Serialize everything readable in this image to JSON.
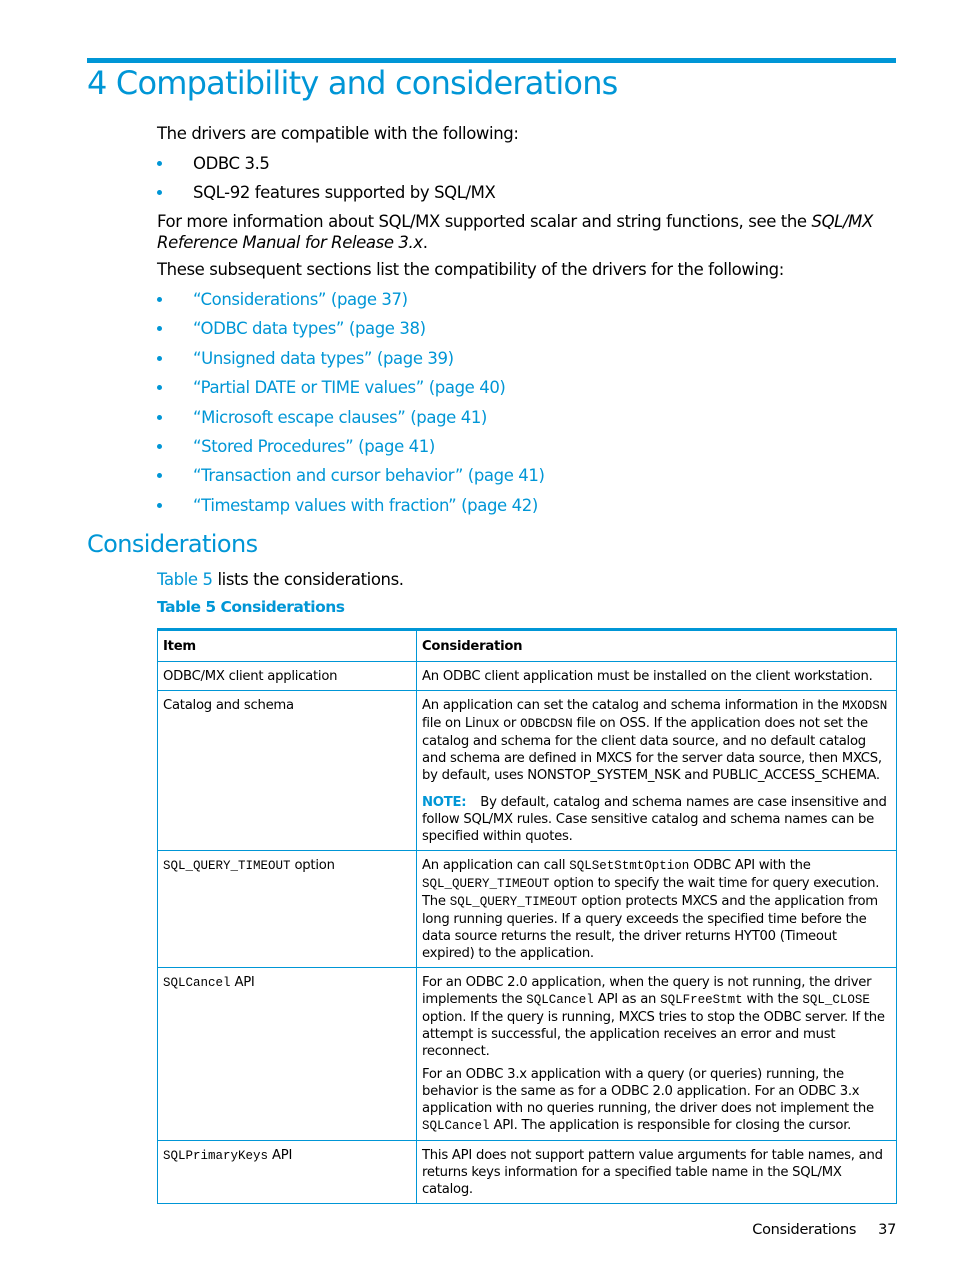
{
  "chapter": {
    "title": "4 Compatibility and considerations",
    "intro": "The drivers are compatible with the following:",
    "compat_items": [
      "ODBC 3.5",
      "SQL-92 features supported by SQL/MX"
    ],
    "more_info_text": "For more information about SQL/MX supported scalar and string functions, see the ",
    "more_info_ref": "SQL/MX Reference Manual for Release 3.x",
    "more_info_end": ".",
    "sections_intro": "These subsequent sections list the compatibility of the drivers for the following:",
    "section_links": [
      "“Considerations” (page 37)",
      "“ODBC data types” (page 38)",
      "“Unsigned data types” (page 39)",
      "“Partial DATE or TIME values” (page 40)",
      "“Microsoft escape clauses” (page 41)",
      "“Stored Procedures” (page 41)",
      "“Transaction and cursor behavior” (page 41)",
      "“Timestamp values with fraction” (page 42)"
    ]
  },
  "considerations": {
    "title": "Considerations",
    "table_ref_link": "Table 5",
    "table_ref_text": " lists the considerations.",
    "table_caption": "Table 5 Considerations",
    "table": {
      "headers": [
        "Item",
        "Consideration"
      ],
      "rows": [
        {
          "item_text": "ODBC/MX client application",
          "p1": "An ODBC client application must be installed on the client workstation."
        },
        {
          "item_text": "Catalog and schema",
          "p1_a": "An application can set the catalog and schema information in the ",
          "p1_code1": "MXODSN",
          "p1_b": " file on Linux or ",
          "p1_code2": "ODBCDSN",
          "p1_c": " file on OSS. If the application does not set the catalog and schema for the client data source, and no default catalog and schema are defined in MXCS for the server data source, then MXCS, by default, uses NONSTOP_SYSTEM_NSK and PUBLIC_ACCESS_SCHEMA.",
          "note_label": "NOTE:",
          "note_text": "By default, catalog and schema names are case insensitive and follow SQL/MX rules. Case sensitive catalog and schema names can be specified within quotes."
        },
        {
          "item_code": "SQL_QUERY_TIMEOUT",
          "item_suffix": " option",
          "p1_a": "An application can call ",
          "p1_code1": "SQLSetStmtOption",
          "p1_b": " ODBC API with the ",
          "p1_code2": "SQL_QUERY_TIMEOUT",
          "p1_c": " option to specify the wait time for query execution. The ",
          "p1_code3": "SQL_QUERY_TIMEOUT",
          "p1_d": " option protects MXCS and the application from long running queries. If a query exceeds the specified time before the data source returns the result, the driver returns HYT00 (Timeout expired) to the application."
        },
        {
          "item_code": "SQLCancel",
          "item_suffix": " API",
          "p1_a": "For an ODBC 2.0 application, when the query is not running, the driver implements the ",
          "p1_code1": "SQLCancel",
          "p1_b": " API as an ",
          "p1_code2": "SQLFreeStmt",
          "p1_c": " with the ",
          "p1_code3": "SQL_CLOSE",
          "p1_d": " option. If the query is running, MXCS tries to stop the ODBC server. If the attempt is successful, the application receives an error and must reconnect.",
          "p2_a": "For an ODBC 3.x application with a query (or queries) running, the behavior is the same as for a ODBC 2.0 application. For an ODBC 3.x application with no queries running, the driver does not implement the ",
          "p2_code1": "SQLCancel",
          "p2_b": " API. The application is responsible for closing the cursor."
        },
        {
          "item_code": "SQLPrimaryKeys",
          "item_suffix": " API",
          "p1": "This API does not support pattern value arguments for table names, and returns keys information for a specified table name in the SQL/MX catalog."
        }
      ]
    }
  },
  "footer": {
    "section": "Considerations",
    "page_number": "37"
  },
  "colors": {
    "accent": "#0096d6",
    "text": "#000000"
  }
}
